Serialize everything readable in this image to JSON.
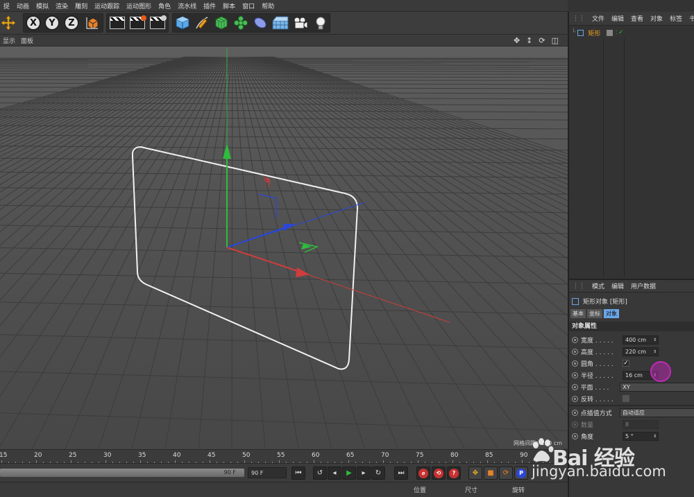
{
  "menubar": [
    "捉",
    "动画",
    "模拟",
    "渲染",
    "雕刻",
    "运动跟踪",
    "运动图形",
    "角色",
    "流水线",
    "插件",
    "脚本",
    "窗口",
    "帮助"
  ],
  "toolbar": {
    "icons": [
      "move-tool",
      "x-axis-lock",
      "y-axis-lock",
      "z-axis-lock",
      "coordinate-system",
      "render-view",
      "render-picture-viewer",
      "render-settings",
      "cube-object",
      "pen-tool",
      "subdivision-surface",
      "cloner",
      "deformer",
      "floor",
      "camera",
      "light"
    ],
    "xyz": [
      "X",
      "Y",
      "Z"
    ]
  },
  "viewport": {
    "menu": [
      "显示",
      "面板"
    ],
    "nav_icons": [
      "move-view-icon",
      "zoom-view-icon",
      "rotate-view-icon",
      "toggle-view-icon"
    ],
    "grid_label": "网格间距：100 cm"
  },
  "timeline": {
    "ticks": [
      "15",
      "20",
      "25",
      "30",
      "35",
      "40",
      "45",
      "50",
      "55",
      "60",
      "65",
      "70",
      "75",
      "80",
      "85",
      "90"
    ],
    "slider_value": "90 F",
    "frame_field": "90 F"
  },
  "bottom_bar": {
    "position": "位置",
    "size": "尺寸",
    "rotation": "旋转"
  },
  "object_manager": {
    "menu": [
      "文件",
      "编辑",
      "查看",
      "对象",
      "标签",
      "书签"
    ],
    "object_name": "矩形",
    "check": "✓"
  },
  "attribute_manager": {
    "menu": [
      "模式",
      "编辑",
      "用户数据"
    ],
    "title": "矩形对象 [矩形]",
    "tabs": [
      "基本",
      "坐标",
      "对象"
    ],
    "section": "对象属性",
    "props": [
      {
        "label": "宽度 . . . . .",
        "value": "400 cm"
      },
      {
        "label": "高度 . . . . .",
        "value": "220 cm"
      },
      {
        "label": "圆角 . . . . .",
        "value": "✓"
      },
      {
        "label": "半径 . . . . .",
        "value": "16 cm"
      },
      {
        "label": "平面 . . . . .",
        "value": "XY"
      },
      {
        "label": "反转 . . . . .",
        "value": ""
      }
    ],
    "interp_label": "点插值方式",
    "interp_value": "自动适应",
    "count_label": "数量",
    "count_value": "8",
    "angle_label": "角度",
    "angle_value": "5 °"
  },
  "watermark": {
    "brand": "Bai 经验",
    "url": "jingyan.baidu.com"
  },
  "colors": {
    "x_axis": "#d23c3c",
    "y_axis": "#2fbd3c",
    "z_axis": "#2a47d6",
    "spline": "#f2f2f2",
    "accent": "#6aa6e8",
    "cursor": "#c02ab8"
  }
}
